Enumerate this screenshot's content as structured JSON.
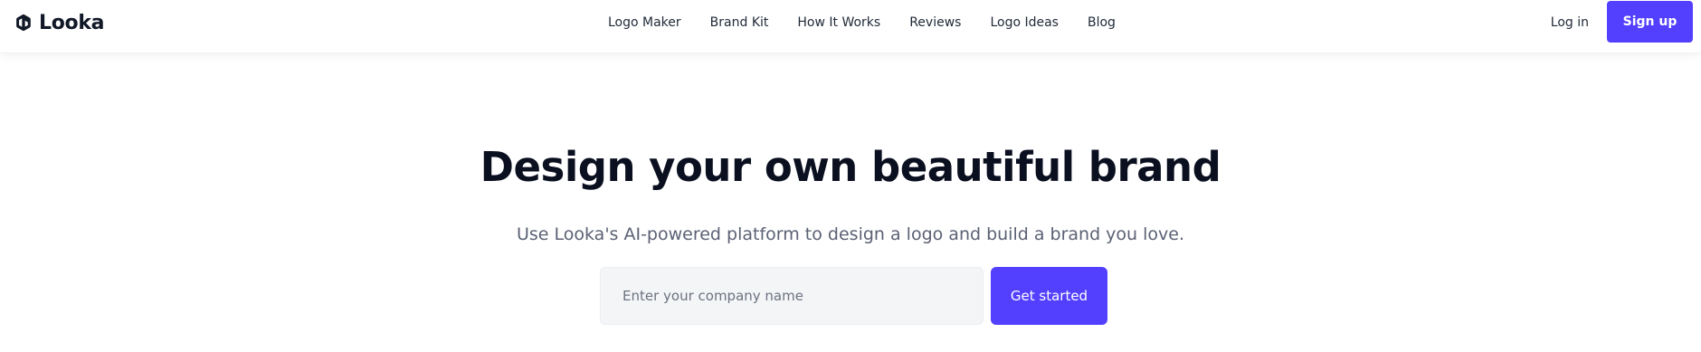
{
  "brand": {
    "name": "Looka",
    "accent_color": "#5340ff",
    "logo_icon": "looka-logo-icon"
  },
  "header": {
    "nav": [
      {
        "label": "Logo Maker"
      },
      {
        "label": "Brand Kit"
      },
      {
        "label": "How It Works"
      },
      {
        "label": "Reviews"
      },
      {
        "label": "Logo Ideas"
      },
      {
        "label": "Blog"
      }
    ],
    "login_label": "Log in",
    "signup_label": "Sign up"
  },
  "hero": {
    "title": "Design your own beautiful brand",
    "subtitle": "Use Looka's AI-powered platform to design a logo and build a brand you love.",
    "input": {
      "placeholder": "Enter your company name",
      "value": ""
    },
    "cta_label": "Get started"
  }
}
